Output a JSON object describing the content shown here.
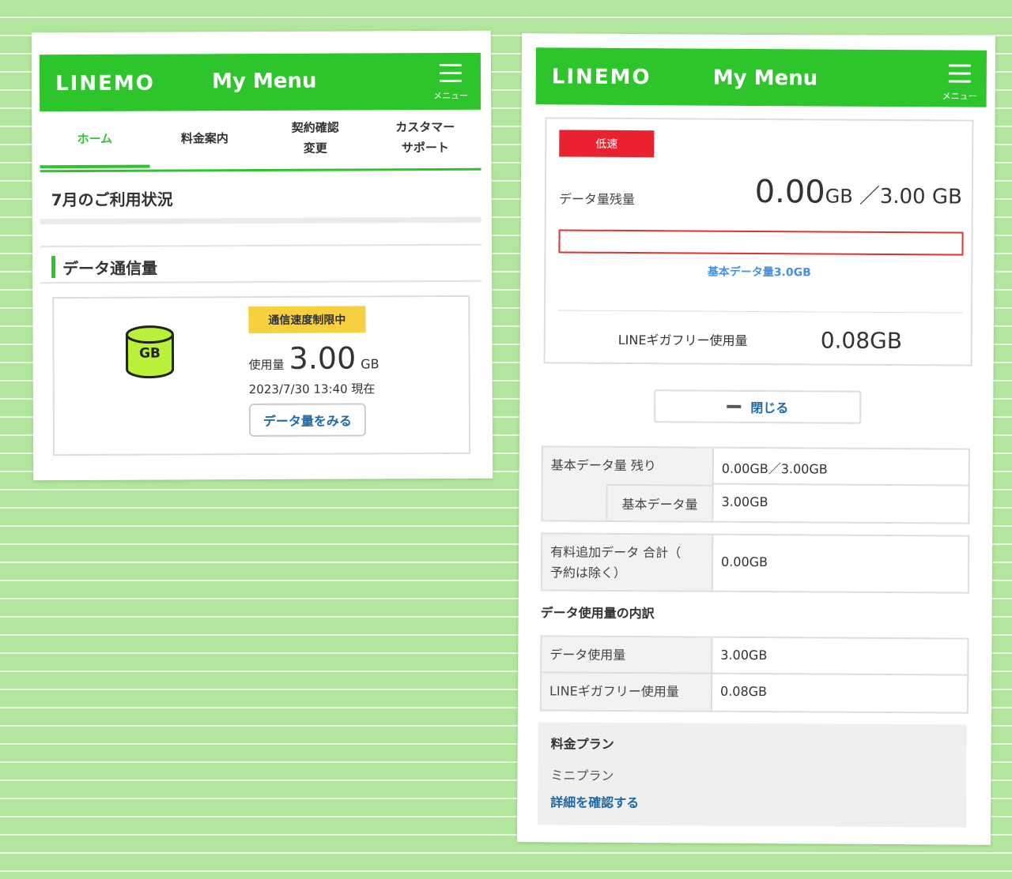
{
  "colors": {
    "brand_green": "#2ec52c",
    "background": "#b2e69d",
    "limit_yellow": "#f7d040",
    "slow_red": "#e8232f",
    "link_blue": "#1e6aa8",
    "caption_blue": "#4a90e2"
  },
  "left": {
    "header": {
      "logo": "LINEMO",
      "title": "My Menu",
      "menu_label": "メニュー",
      "menu_icon": "hamburger-icon"
    },
    "tabs": [
      {
        "label": "ホーム",
        "active": true
      },
      {
        "label": "料金案内",
        "active": false
      },
      {
        "label": "契約確認\n変更",
        "active": false
      },
      {
        "label": "カスタマー\nサポート",
        "active": false
      }
    ],
    "month_title": "7月のご利用状況",
    "section_title": "データ通信量",
    "data_card": {
      "icon": "gb-database-icon",
      "icon_text": "GB",
      "limit_badge": "通信速度制限中",
      "usage_label": "使用量",
      "usage_value": "3.00",
      "usage_unit": "GB",
      "timestamp": "2023/7/30 13:40 現在",
      "button": "データ量をみる"
    }
  },
  "right": {
    "header": {
      "logo": "LINEMO",
      "title": "My Menu",
      "menu_label": "メニュー",
      "menu_icon": "hamburger-icon"
    },
    "detail": {
      "speed_badge": "低速",
      "remaining_label": "データ量残量",
      "remaining_value": "0.00",
      "remaining_unit": "GB",
      "remaining_total": "／3.00 GB",
      "remaining_fraction": 0,
      "meter_caption": "基本データ量3.0GB",
      "free_label": "LINEギガフリー使用量",
      "free_value": "0.08GB"
    },
    "close_button": "閉じる",
    "table1": {
      "row1_label": "基本データ量 残り",
      "row1_value": "0.00GB／3.00GB",
      "row2_label": "基本データ量",
      "row2_value": "3.00GB"
    },
    "table2": {
      "label": "有料追加データ 合計（\n予約は除く）",
      "value": "0.00GB"
    },
    "breakdown_title": "データ使用量の内訳",
    "table3": {
      "row1_label": "データ使用量",
      "row1_value": "3.00GB",
      "row2_label": "LINEギガフリー使用量",
      "row2_value": "0.08GB"
    },
    "plan": {
      "title": "料金プラン",
      "name": "ミニプラン",
      "link": "詳細を確認する"
    }
  }
}
